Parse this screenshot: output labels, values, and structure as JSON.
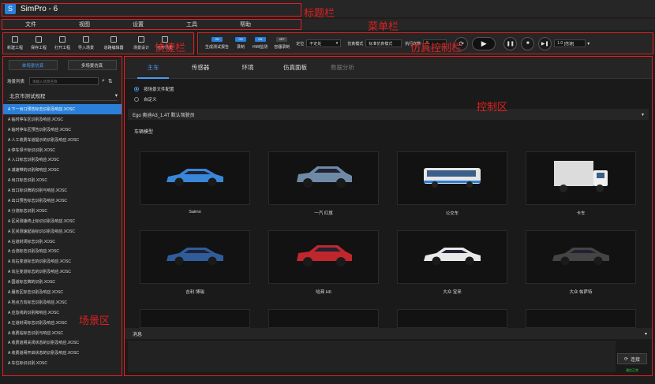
{
  "app": {
    "title": "SimPro - 6"
  },
  "menu": [
    "文件",
    "视图",
    "设置",
    "工具",
    "帮助"
  ],
  "quick_bar": {
    "buttons": [
      "新建工程",
      "保存工程",
      "打开工程",
      "导入场景",
      "道路编辑器",
      "场景设计",
      "打开场景"
    ]
  },
  "sim_bar": {
    "toggles": [
      {
        "label": "生成测试报告",
        "state": "ON"
      },
      {
        "label": "录制",
        "state": "ON"
      },
      {
        "label": "HMI监测",
        "state": "ON"
      },
      {
        "label": "容器录制",
        "state": "OFF"
      }
    ],
    "trigger_label": "定位",
    "trigger_value": "不定处",
    "mode_label": "仿真模式",
    "mode_value": "标准仿真模式",
    "runs_label": "执行次数",
    "runs_value": "5",
    "speed_value": "1.0",
    "speed_unit": "[倍速]"
  },
  "annotations": {
    "title_bar": "标题栏",
    "menu_bar": "菜单栏",
    "quick_bar": "快捷栏",
    "sim_control": "仿真控制栏",
    "control_area": "控制区",
    "scene_area": "场景区"
  },
  "scene_panel": {
    "tabs": [
      "单场景仿真",
      "多场景仿真"
    ],
    "search_label": "场景列表",
    "search_placeholder": "请输入场景名称",
    "group": "北京市测试规程",
    "items": [
      "A 下一出口预告标志识别及响应.XOSC",
      "A 临时停车区识别及响应.XOSC",
      "A 临时停车区预告识别及响应.XOSC",
      "A 人工收费车道提示的识别及响应.XOSC",
      "A 停车领卡标识识别.XOSC",
      "A 入口标志识别及响应.XOSC",
      "A 减速带的识别和响应.XOSC",
      "A 出口标志识别.XOSC",
      "A 出口标识牌的识别与响应.XOSC",
      "A 出口预告标志识别及响应.XOSC",
      "A 分流标志识别.XOSC",
      "A 区间测速终止标识识别及响应.XOSC",
      "A 区间测速起始标识识别及响应.XOSC",
      "A 右道封闭标志识别.XOSC",
      "A 合流标志识别及响应.XOSC",
      "A 向右变道标志的识别及响应.XOSC",
      "A 向左变道标志的识别及响应.XOSC",
      "A 国道标志牌的识别.XOSC",
      "A 服务区标志识别及响应.XOSC",
      "A 地点方向标志识别及响应.XOSC",
      "A 应急线的识别和响应.XOSC",
      "A 左道封闭标志识别及响应.XOSC",
      "A 收费站标志识别与响应.XOSC",
      "A 收费道闸关闭状态的识别及响应.XOSC",
      "A 收费道闸开启状态的识别及响应.XOSC",
      "A 车位标识识别.XOSC"
    ]
  },
  "main_tabs": [
    "主车",
    "传感器",
    "环境",
    "仿真面板",
    "数据分析"
  ],
  "config": {
    "options": [
      "按场景文件配置",
      "自定义"
    ],
    "driver": "Ego 奥迪A3_1.4T 默认驾驶员"
  },
  "vehicles": {
    "section_title": "车辆模型",
    "items": [
      {
        "name": "Saimo",
        "color": "#3a86d8",
        "kind": "sedan"
      },
      {
        "name": "一汽 红旗",
        "color": "#6f8aa6",
        "kind": "suv"
      },
      {
        "name": "公交车",
        "color": "#e6e6e6",
        "kind": "bus"
      },
      {
        "name": "卡车",
        "color": "#dcdcdc",
        "kind": "truck"
      },
      {
        "name": "吉利 博瑞",
        "color": "#2f5d9c",
        "kind": "sedan"
      },
      {
        "name": "哈弗 H6",
        "color": "#c0272d",
        "kind": "suv"
      },
      {
        "name": "大众 宝来",
        "color": "#e8e8e8",
        "kind": "sedan"
      },
      {
        "name": "大众 帕萨特",
        "color": "#444444",
        "kind": "sedan"
      }
    ]
  },
  "message": {
    "title": "消息",
    "connect_label": "连接",
    "status": "通信正常"
  }
}
